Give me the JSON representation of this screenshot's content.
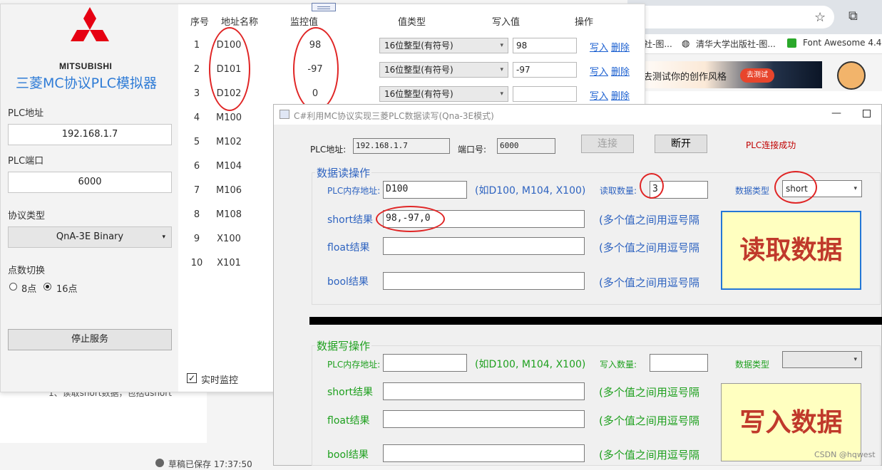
{
  "browser": {
    "bookmarks": [
      "社-图...",
      "清华大学出版社-图...",
      "Font Awesome 4.4..."
    ],
    "ad": {
      "text": "去测试你的创作风格",
      "button": "去测试"
    },
    "blog_line": "1、读取short数据，包括ushort",
    "draft_status": "草稿已保存 17:37:50",
    "watermark": "CSDN @hqwest"
  },
  "simulator": {
    "logo_text": "MITSUBISHI",
    "title": "三菱MC协议PLC模拟器",
    "ip_label": "PLC地址",
    "ip_value": "192.168.1.7",
    "port_label": "PLC端口",
    "port_value": "6000",
    "protocol_label": "协议类型",
    "protocol_value": "QnA-3E Binary",
    "points_label": "点数切换",
    "radio_8": "8点",
    "radio_16": "16点",
    "stop_button": "停止服务",
    "monitor_checkbox": "实时监控",
    "table": {
      "headers": [
        "序号",
        "地址名称",
        "监控值",
        "值类型",
        "写入值",
        "操作"
      ],
      "rows": [
        {
          "no": "1",
          "addr": "D100",
          "val": "98",
          "type": "16位整型(有符号)",
          "write": "98",
          "op_write": "写入",
          "op_delete": "删除"
        },
        {
          "no": "2",
          "addr": "D101",
          "val": "-97",
          "type": "16位整型(有符号)",
          "write": "-97",
          "op_write": "写入",
          "op_delete": "删除"
        },
        {
          "no": "3",
          "addr": "D102",
          "val": "0",
          "type": "16位整型(有符号)",
          "write": "",
          "op_write": "写入",
          "op_delete": "删除"
        },
        {
          "no": "4",
          "addr": "M100"
        },
        {
          "no": "5",
          "addr": "M102"
        },
        {
          "no": "6",
          "addr": "M104"
        },
        {
          "no": "7",
          "addr": "M106"
        },
        {
          "no": "8",
          "addr": "M108"
        },
        {
          "no": "9",
          "addr": "X100"
        },
        {
          "no": "10",
          "addr": "X101"
        }
      ]
    }
  },
  "client": {
    "window_title": "C#利用MC协议实现三菱PLC数据读写(Qna-3E模式)",
    "plc_addr_label": "PLC地址:",
    "plc_addr_value": "192.168.1.7",
    "port_label": "端口号:",
    "port_value": "6000",
    "connect_button": "连接",
    "disconnect_button": "断开",
    "status": "PLC连接成功",
    "read": {
      "group_title": "数据读操作",
      "mem_label": "PLC内存地址:",
      "mem_value": "D100",
      "example": "(如D100, M104, X100)",
      "count_label": "读取数量:",
      "count_value": "3",
      "type_label": "数据类型",
      "type_value": "short",
      "short_label": "short结果",
      "short_value": "98,-97,0",
      "float_label": "float结果",
      "float_value": "",
      "bool_label": "bool结果",
      "bool_value": "",
      "hint": "(多个值之间用逗号隔",
      "button": "读取数据"
    },
    "write": {
      "group_title": "数据写操作",
      "mem_label": "PLC内存地址:",
      "mem_value": "",
      "example": "(如D100, M104, X100)",
      "count_label": "写入数量:",
      "count_value": "",
      "type_label": "数据类型",
      "type_value": "",
      "short_label": "short结果",
      "float_label": "float结果",
      "bool_label": "bool结果",
      "hint": "(多个值之间用逗号隔",
      "button": "写入数据"
    }
  },
  "colors": {
    "accent_blue": "#2e63c0",
    "green": "#1ea01e",
    "annotation_red": "#e02525",
    "status_red": "#c00000",
    "button_yellow": "#ffffc0"
  }
}
